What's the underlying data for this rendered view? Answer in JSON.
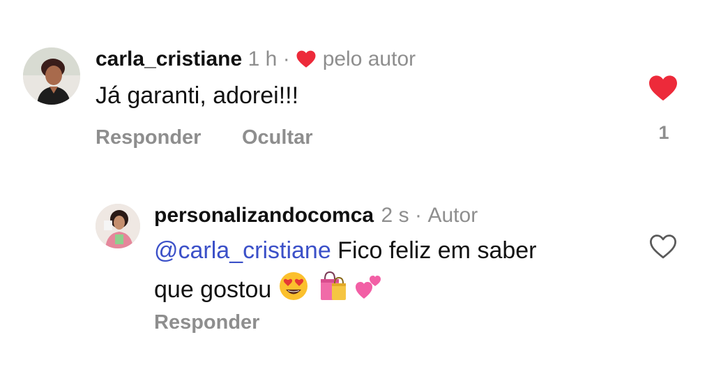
{
  "comments": [
    {
      "username": "carla_cristiane",
      "time": "1 h",
      "separator": "·",
      "liked_by_author_label": "pelo autor",
      "text": "Já garanti, adorei!!!",
      "actions": {
        "reply": "Responder",
        "hide": "Ocultar"
      },
      "like_count": "1",
      "liked": true
    },
    {
      "username": "personalizandocomca",
      "time": "2 s",
      "separator": "·",
      "author_badge": "Autor",
      "mention": "@carla_cristiane",
      "text_line1": " Fico feliz em saber",
      "text_line2": "que gostou ",
      "emojis": [
        "heart-eyes-emoji",
        "shopping-bags-emoji",
        "two-hearts-emoji"
      ],
      "actions": {
        "reply": "Responder"
      },
      "liked": false
    }
  ],
  "colors": {
    "heart_red": "#ed2a3a",
    "meta_gray": "#8e8e8e",
    "mention_blue": "#3b50c8"
  }
}
